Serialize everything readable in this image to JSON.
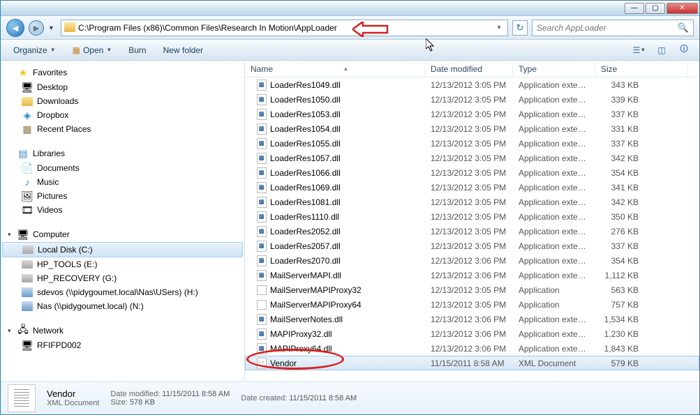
{
  "address_path": "C:\\Program Files (x86)\\Common Files\\Research In Motion\\AppLoader",
  "search_placeholder": "Search AppLoader",
  "toolbar": {
    "organize": "Organize",
    "open": "Open",
    "burn": "Burn",
    "newfolder": "New folder"
  },
  "nav": {
    "favorites": {
      "label": "Favorites",
      "items": [
        "Desktop",
        "Downloads",
        "Dropbox",
        "Recent Places"
      ]
    },
    "libraries": {
      "label": "Libraries",
      "items": [
        "Documents",
        "Music",
        "Pictures",
        "Videos"
      ]
    },
    "computer": {
      "label": "Computer",
      "items": [
        "Local Disk (C:)",
        "HP_TOOLS (E:)",
        "HP_RECOVERY (G:)",
        "sdevos (\\\\pidygoumet.local\\Nas\\USers) (H:)",
        "Nas (\\\\pidygoumet.local) (N:)"
      ]
    },
    "network": {
      "label": "Network",
      "items": [
        "RFIFPD002"
      ]
    }
  },
  "columns": {
    "name": "Name",
    "date": "Date modified",
    "type": "Type",
    "size": "Size"
  },
  "files": [
    {
      "name": "LoaderRes1049.dll",
      "date": "12/13/2012 3:05 PM",
      "type": "Application extens...",
      "size": "343 KB",
      "icon": "dll"
    },
    {
      "name": "LoaderRes1050.dll",
      "date": "12/13/2012 3:05 PM",
      "type": "Application extens...",
      "size": "339 KB",
      "icon": "dll"
    },
    {
      "name": "LoaderRes1053.dll",
      "date": "12/13/2012 3:05 PM",
      "type": "Application extens...",
      "size": "337 KB",
      "icon": "dll"
    },
    {
      "name": "LoaderRes1054.dll",
      "date": "12/13/2012 3:05 PM",
      "type": "Application extens...",
      "size": "331 KB",
      "icon": "dll"
    },
    {
      "name": "LoaderRes1055.dll",
      "date": "12/13/2012 3:05 PM",
      "type": "Application extens...",
      "size": "337 KB",
      "icon": "dll"
    },
    {
      "name": "LoaderRes1057.dll",
      "date": "12/13/2012 3:05 PM",
      "type": "Application extens...",
      "size": "342 KB",
      "icon": "dll"
    },
    {
      "name": "LoaderRes1066.dll",
      "date": "12/13/2012 3:05 PM",
      "type": "Application extens...",
      "size": "354 KB",
      "icon": "dll"
    },
    {
      "name": "LoaderRes1069.dll",
      "date": "12/13/2012 3:05 PM",
      "type": "Application extens...",
      "size": "341 KB",
      "icon": "dll"
    },
    {
      "name": "LoaderRes1081.dll",
      "date": "12/13/2012 3:05 PM",
      "type": "Application extens...",
      "size": "342 KB",
      "icon": "dll"
    },
    {
      "name": "LoaderRes1110.dll",
      "date": "12/13/2012 3:05 PM",
      "type": "Application extens...",
      "size": "350 KB",
      "icon": "dll"
    },
    {
      "name": "LoaderRes2052.dll",
      "date": "12/13/2012 3:05 PM",
      "type": "Application extens...",
      "size": "276 KB",
      "icon": "dll"
    },
    {
      "name": "LoaderRes2057.dll",
      "date": "12/13/2012 3:05 PM",
      "type": "Application extens...",
      "size": "337 KB",
      "icon": "dll"
    },
    {
      "name": "LoaderRes2070.dll",
      "date": "12/13/2012 3:06 PM",
      "type": "Application extens...",
      "size": "354 KB",
      "icon": "dll"
    },
    {
      "name": "MailServerMAPI.dll",
      "date": "12/13/2012 3:06 PM",
      "type": "Application extens...",
      "size": "1,112 KB",
      "icon": "dll"
    },
    {
      "name": "MailServerMAPIProxy32",
      "date": "12/13/2012 3:05 PM",
      "type": "Application",
      "size": "563 KB",
      "icon": "exe"
    },
    {
      "name": "MailServerMAPIProxy64",
      "date": "12/13/2012 3:05 PM",
      "type": "Application",
      "size": "757 KB",
      "icon": "exe"
    },
    {
      "name": "MailServerNotes.dll",
      "date": "12/13/2012 3:06 PM",
      "type": "Application extens...",
      "size": "1,534 KB",
      "icon": "dll"
    },
    {
      "name": "MAPIProxy32.dll",
      "date": "12/13/2012 3:06 PM",
      "type": "Application extens...",
      "size": "1,230 KB",
      "icon": "dll"
    },
    {
      "name": "MAPIProxy64.dll",
      "date": "12/13/2012 3:06 PM",
      "type": "Application extens...",
      "size": "1,843 KB",
      "icon": "dll"
    },
    {
      "name": "Vendor",
      "date": "11/15/2011 8:58 AM",
      "type": "XML Document",
      "size": "579 KB",
      "icon": "xml",
      "selected": true
    }
  ],
  "details": {
    "name": "Vendor",
    "type": "XML Document",
    "date_modified_label": "Date modified:",
    "date_modified": "11/15/2011 8:58 AM",
    "size_label": "Size:",
    "size": "578 KB",
    "date_created_label": "Date created:",
    "date_created": "11/15/2011 8:58 AM"
  }
}
